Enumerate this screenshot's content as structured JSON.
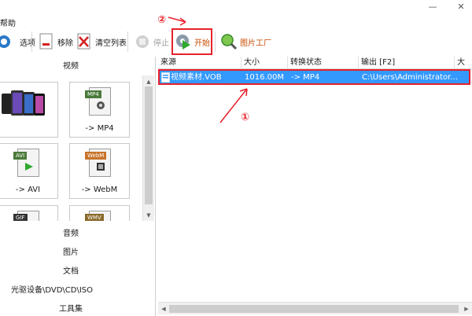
{
  "menu": {
    "help": "帮助"
  },
  "toolbar": {
    "options": "选项",
    "remove": "移除",
    "clear_list": "清空列表",
    "stop": "停止",
    "start": "开始",
    "picture_factory": "图片工厂"
  },
  "left": {
    "video_category": "视频",
    "tiles": [
      {
        "label": "",
        "format": ""
      },
      {
        "label": "-> MP4",
        "format": "MP4"
      },
      {
        "label": "-> AVI",
        "format": "AVI"
      },
      {
        "label": "-> WebM",
        "format": "WebM"
      },
      {
        "label": "",
        "format": "GIF"
      },
      {
        "label": "",
        "format": "WMV"
      }
    ],
    "categories": [
      "音频",
      "图片",
      "文档",
      "光驱设备\\DVD\\CD\\ISO",
      "工具集"
    ]
  },
  "table": {
    "headers": [
      "来源",
      "大小",
      "转换状态",
      "输出 [F2]",
      "大小"
    ],
    "rows": [
      {
        "source": "视频素材.VOB",
        "size": "1016.00M",
        "status": "-> MP4",
        "output": "C:\\Users\\Administrator..."
      }
    ]
  },
  "annotations": {
    "step1": "①",
    "step2": "②"
  },
  "colors": {
    "selection": "#3399ff",
    "annotation": "#e8212a"
  }
}
